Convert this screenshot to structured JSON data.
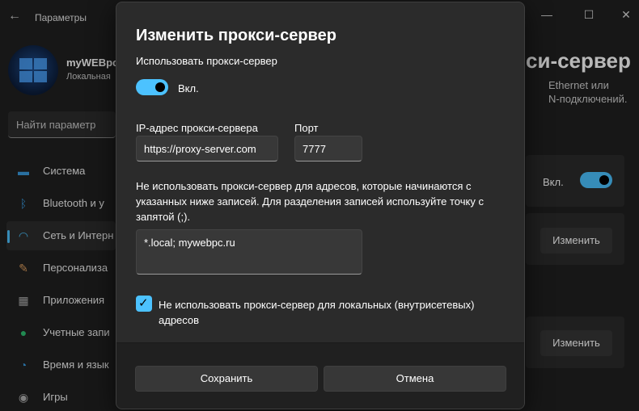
{
  "window": {
    "app_title": "Параметры",
    "back_icon": "←",
    "minimize_icon": "—",
    "maximize_icon": "☐",
    "close_icon": "✕"
  },
  "user": {
    "name": "myWEBpc",
    "subtitle": "Локальная"
  },
  "search": {
    "placeholder": "Найти параметр"
  },
  "sidebar": {
    "items": [
      {
        "label": "Система",
        "icon": "monitor-icon",
        "color": "#3a9be0"
      },
      {
        "label": "Bluetooth и у",
        "icon": "bluetooth-icon",
        "color": "#3a9be0"
      },
      {
        "label": "Сеть и Интерн",
        "icon": "wifi-icon",
        "color": "#4cc2ff",
        "active": true
      },
      {
        "label": "Персонализа",
        "icon": "brush-icon",
        "color": "#e0a060"
      },
      {
        "label": "Приложения",
        "icon": "apps-icon",
        "color": "#b0b0b0"
      },
      {
        "label": "Учетные запи",
        "icon": "person-icon",
        "color": "#2fbf71"
      },
      {
        "label": "Время и язык",
        "icon": "clock-globe-icon",
        "color": "#3a9be0"
      },
      {
        "label": "Игры",
        "icon": "gamepad-icon",
        "color": "#b0b0b0"
      }
    ]
  },
  "background_page": {
    "title": "си-сервер",
    "desc_line1": "Ethernet или",
    "desc_line2": "N-подключений.",
    "toggle_label": "Вкл.",
    "edit_button_1": "Изменить",
    "edit_button_2": "Изменить"
  },
  "dialog": {
    "title": "Изменить прокси-сервер",
    "use_proxy_label": "Использовать прокси-сервер",
    "toggle_state": "Вкл.",
    "ip_label": "IP-адрес прокси-сервера",
    "ip_value": "https://proxy-server.com",
    "port_label": "Порт",
    "port_value": "7777",
    "exceptions_desc": "Не использовать прокси-сервер для адресов, которые начинаются с указанных ниже записей. Для разделения записей используйте точку с запятой (;).",
    "exceptions_value": "*.local; mywebpc.ru",
    "local_bypass_label": "Не использовать прокси-сервер для локальных (внутрисетевых) адресов",
    "local_bypass_checked": true,
    "save_label": "Сохранить",
    "cancel_label": "Отмена"
  },
  "colors": {
    "accent": "#4cc2ff",
    "background": "#202020",
    "dialog_bg": "#2b2b2b"
  }
}
